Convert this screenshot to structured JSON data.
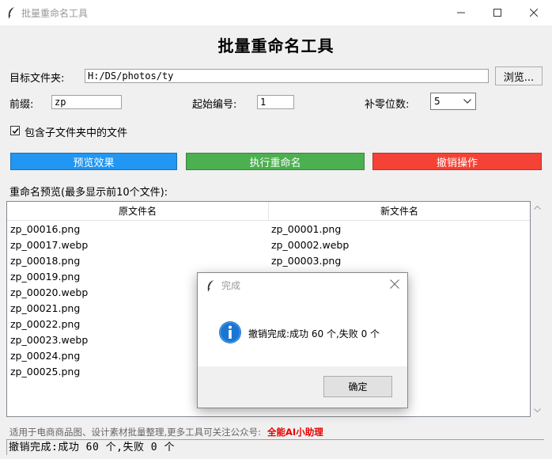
{
  "window": {
    "title": "批量重命名工具"
  },
  "heading": "批量重命名工具",
  "folder": {
    "label": "目标文件夹:",
    "value": "H:/DS/photos/ty",
    "browse_label": "浏览..."
  },
  "prefix": {
    "label": "前缀:",
    "value": "zp"
  },
  "start": {
    "label": "起始编号:",
    "value": "1"
  },
  "padding": {
    "label": "补零位数:",
    "value": "5"
  },
  "subfolders": {
    "label": "包含子文件夹中的文件",
    "checked": true
  },
  "buttons": {
    "preview": {
      "label": "预览效果",
      "color": "#2196f3"
    },
    "execute": {
      "label": "执行重命名",
      "color": "#4caf50"
    },
    "undo": {
      "label": "撤销操作",
      "color": "#f44336"
    }
  },
  "preview_title": "重命名预览(最多显示前10个文件):",
  "table": {
    "columns": [
      "原文件名",
      "新文件名"
    ],
    "rows": [
      [
        "zp_00016.png",
        "zp_00001.png"
      ],
      [
        "zp_00017.webp",
        "zp_00002.webp"
      ],
      [
        "zp_00018.png",
        "zp_00003.png"
      ],
      [
        "zp_00019.png",
        ""
      ],
      [
        "zp_00020.webp",
        ""
      ],
      [
        "zp_00021.png",
        ""
      ],
      [
        "zp_00022.png",
        ""
      ],
      [
        "zp_00023.webp",
        ""
      ],
      [
        "zp_00024.png",
        ""
      ],
      [
        "zp_00025.png",
        ""
      ]
    ]
  },
  "footnote": {
    "text": "适用于电商商品图、设计素材批量整理,更多工具可关注公众号:",
    "highlight": "全能AI小助理"
  },
  "status": "撤销完成:成功 60 个,失败 0 个",
  "dialog": {
    "title": "完成",
    "message": "撤销完成:成功 60 个,失败 0 个",
    "ok_label": "确定"
  }
}
